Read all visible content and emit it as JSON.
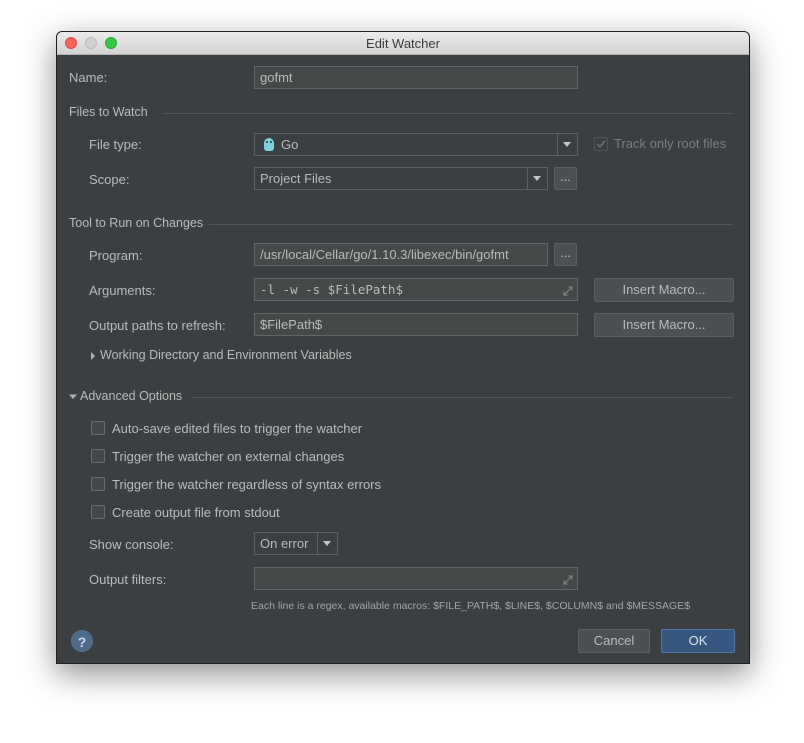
{
  "window": {
    "title": "Edit Watcher"
  },
  "name": {
    "label": "Name:",
    "value": "gofmt"
  },
  "files_to_watch": {
    "heading": "Files to Watch",
    "file_type": {
      "label": "File type:",
      "value": "Go"
    },
    "track_only_root": {
      "label": "Track only root files",
      "checked": true,
      "enabled": false
    },
    "scope": {
      "label": "Scope:",
      "value": "Project Files",
      "browse_label": "..."
    }
  },
  "tool": {
    "heading": "Tool to Run on Changes",
    "program": {
      "label": "Program:",
      "value": "/usr/local/Cellar/go/1.10.3/libexec/bin/gofmt",
      "browse_label": "..."
    },
    "arguments": {
      "label": "Arguments:",
      "value": "-l -w -s $FilePath$",
      "macro_label": "Insert Macro..."
    },
    "output_paths": {
      "label": "Output paths to refresh:",
      "value": "$FilePath$",
      "macro_label": "Insert Macro..."
    },
    "working_dir": {
      "label": "Working Directory and Environment Variables",
      "expanded": false
    }
  },
  "advanced": {
    "heading": "Advanced Options",
    "expanded": true,
    "options": [
      {
        "label": "Auto-save edited files to trigger the watcher",
        "checked": false
      },
      {
        "label": "Trigger the watcher on external changes",
        "checked": false
      },
      {
        "label": "Trigger the watcher regardless of syntax errors",
        "checked": false
      },
      {
        "label": "Create output file from stdout",
        "checked": false
      }
    ],
    "show_console": {
      "label": "Show console:",
      "value": "On error"
    },
    "output_filters": {
      "label": "Output filters:",
      "value": "",
      "hint": "Each line is a regex, available macros: $FILE_PATH$, $LINE$, $COLUMN$ and $MESSAGE$"
    }
  },
  "footer": {
    "help_label": "?",
    "cancel_label": "Cancel",
    "ok_label": "OK"
  },
  "colors": {
    "background": "#3c3f41",
    "accent": "#365880",
    "text": "#bbbbbb"
  }
}
